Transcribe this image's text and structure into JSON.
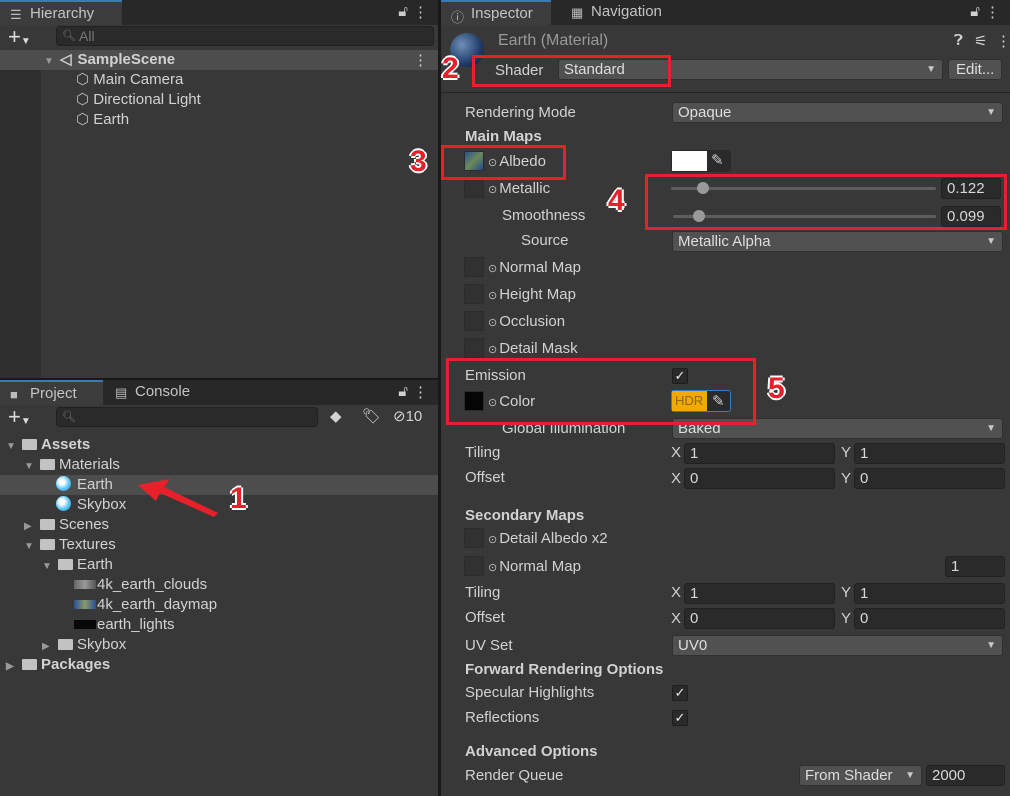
{
  "hierarchy": {
    "tab": "Hierarchy",
    "search_placeholder": "All",
    "scene": "SampleScene",
    "objects": [
      "Main Camera",
      "Directional Light",
      "Earth"
    ]
  },
  "project": {
    "tabs": [
      "Project",
      "Console"
    ],
    "hidden_count": "10",
    "tree": [
      {
        "label": "Assets",
        "depth": 0,
        "type": "folder-open",
        "bold": true
      },
      {
        "label": "Materials",
        "depth": 1,
        "type": "folder-open"
      },
      {
        "label": "Earth",
        "depth": 2,
        "type": "material",
        "selected": true
      },
      {
        "label": "Skybox",
        "depth": 2,
        "type": "material"
      },
      {
        "label": "Scenes",
        "depth": 1,
        "type": "folder"
      },
      {
        "label": "Textures",
        "depth": 1,
        "type": "folder-open"
      },
      {
        "label": "Earth",
        "depth": 2,
        "type": "folder-open"
      },
      {
        "label": "4k_earth_clouds",
        "depth": 3,
        "type": "texture"
      },
      {
        "label": "4k_earth_daymap",
        "depth": 3,
        "type": "texture"
      },
      {
        "label": "earth_lights",
        "depth": 3,
        "type": "texture"
      },
      {
        "label": "Skybox",
        "depth": 2,
        "type": "folder"
      },
      {
        "label": "Packages",
        "depth": 0,
        "type": "folder",
        "bold": true
      }
    ]
  },
  "inspector": {
    "tabs": [
      "Inspector",
      "Navigation"
    ],
    "title": "Earth (Material)",
    "shader_label": "Shader",
    "shader": "Standard",
    "edit_button": "Edit...",
    "rendering_mode_label": "Rendering Mode",
    "rendering_mode": "Opaque",
    "main_maps": "Main Maps",
    "albedo": "Albedo",
    "albedo_color": "#ffffff",
    "metallic": "Metallic",
    "metallic_value": "0.122",
    "metallic_fraction": 0.122,
    "smoothness": "Smoothness",
    "smoothness_value": "0.099",
    "smoothness_fraction": 0.099,
    "source_label": "Source",
    "source": "Metallic Alpha",
    "normal_map": "Normal Map",
    "height_map": "Height Map",
    "occlusion": "Occlusion",
    "detail_mask": "Detail Mask",
    "emission": "Emission",
    "emission_checked": true,
    "color": "Color",
    "hdr": "HDR",
    "hdr_color": "#f2a900",
    "gi_label": "Global Illumination",
    "gi": "Baked",
    "tiling": "Tiling",
    "offset": "Offset",
    "x": "X",
    "y": "Y",
    "tiling_x": "1",
    "tiling_y": "1",
    "offset_x": "0",
    "offset_y": "0",
    "secondary_maps": "Secondary Maps",
    "detail_albedo": "Detail Albedo x2",
    "normal_map2": "Normal Map",
    "normal_scale": "1",
    "tiling2_x": "1",
    "tiling2_y": "1",
    "offset2_x": "0",
    "offset2_y": "0",
    "uv_set_label": "UV Set",
    "uv_set": "UV0",
    "forward": "Forward Rendering Options",
    "specular": "Specular Highlights",
    "reflections": "Reflections",
    "advanced": "Advanced Options",
    "render_queue_label": "Render Queue",
    "render_queue_mode": "From Shader",
    "render_queue": "2000"
  },
  "annotations": [
    "1",
    "2",
    "3",
    "4",
    "5"
  ]
}
